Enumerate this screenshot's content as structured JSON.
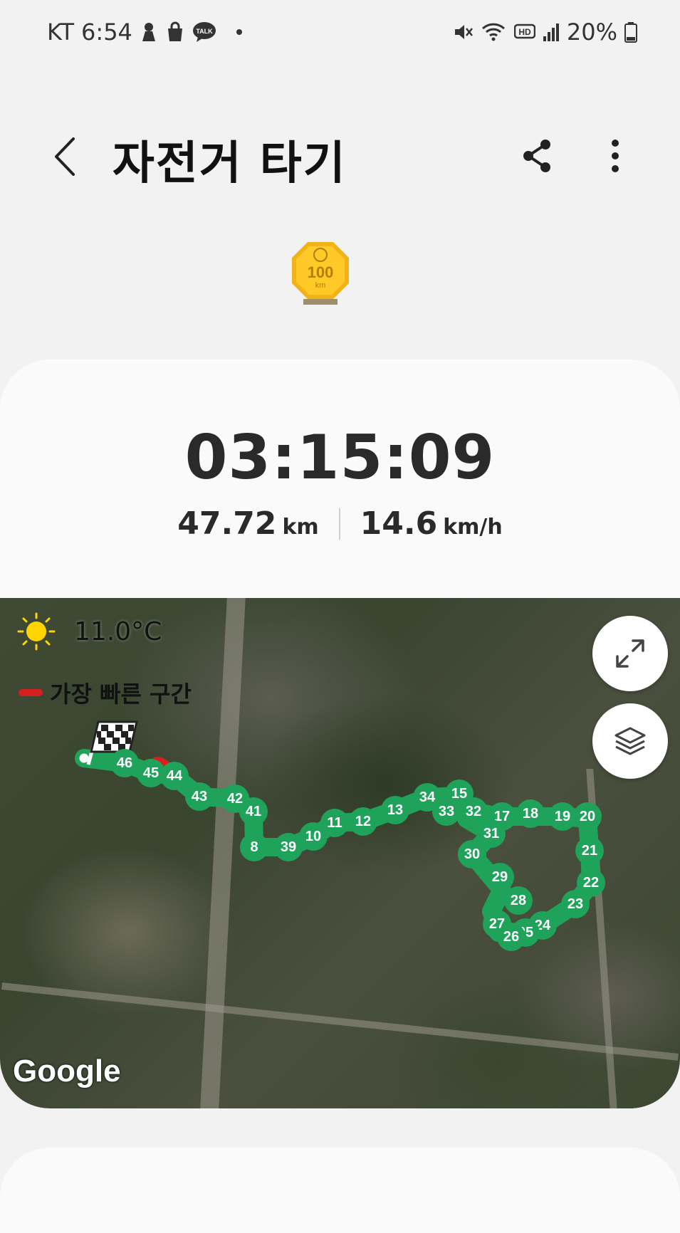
{
  "status_bar": {
    "carrier": "KT",
    "time": "6:54",
    "talk_label": "TALK",
    "hd_label": "HD",
    "battery": "20%"
  },
  "header": {
    "title": "자전거 타기"
  },
  "badge": {
    "value": "100",
    "unit": "km"
  },
  "summary": {
    "duration": "03:15:09",
    "distance_value": "47.72",
    "distance_unit": "km",
    "speed_value": "14.6",
    "speed_unit": "km/h"
  },
  "map": {
    "temperature": "11.0°C",
    "legend_fastest": "가장 빠른 구간",
    "attribution": "Google",
    "route_color": "#1fa35a",
    "fastest_color": "#d62020",
    "markers": [
      "46",
      "45",
      "44",
      "43",
      "42",
      "41",
      "8",
      "39",
      "10",
      "11",
      "12",
      "13",
      "34",
      "15",
      "33",
      "32",
      "17",
      "18",
      "19",
      "20",
      "31",
      "30",
      "21",
      "29",
      "28",
      "22",
      "23",
      "27",
      "24",
      "25",
      "26"
    ]
  },
  "icons": {
    "back": "chevron-left-icon",
    "share": "share-icon",
    "more": "more-vertical-icon",
    "expand": "expand-icon",
    "layers": "layers-icon",
    "weather": "sun-icon",
    "finish": "checkered-flag-icon"
  }
}
